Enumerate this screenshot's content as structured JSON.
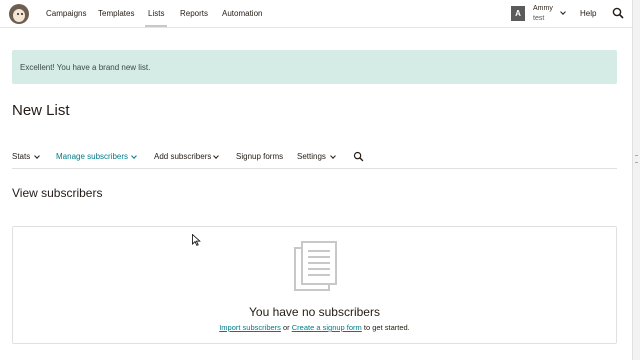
{
  "topnav": {
    "items": [
      {
        "label": "Campaigns"
      },
      {
        "label": "Templates"
      },
      {
        "label": "Lists"
      },
      {
        "label": "Reports"
      },
      {
        "label": "Automation"
      }
    ],
    "active": "Lists",
    "user": {
      "initial": "A",
      "name": "Ammy",
      "account": "test"
    },
    "help_label": "Help"
  },
  "alert": {
    "message": "Excellent! You have a brand new list.",
    "color": "#d5ebe6"
  },
  "page": {
    "title": "New List"
  },
  "subnav": {
    "items": [
      {
        "label": "Stats"
      },
      {
        "label": "Manage subscribers"
      },
      {
        "label": "Add subscribers"
      },
      {
        "label": "Signup forms"
      },
      {
        "label": "Settings"
      }
    ],
    "active": "Manage subscribers"
  },
  "section": {
    "title": "View subscribers"
  },
  "empty_state": {
    "title": "You have no subscribers",
    "link1": "Import subscribers",
    "connector": "or",
    "link2": "Create a signup form",
    "suffix": "to get started."
  },
  "colors": {
    "accent": "#007c89",
    "text": "#241c15"
  },
  "icons": [
    "mailchimp-logo-icon",
    "search-icon",
    "chevron-down-icon",
    "document-list-icon",
    "mouse-cursor-icon"
  ]
}
